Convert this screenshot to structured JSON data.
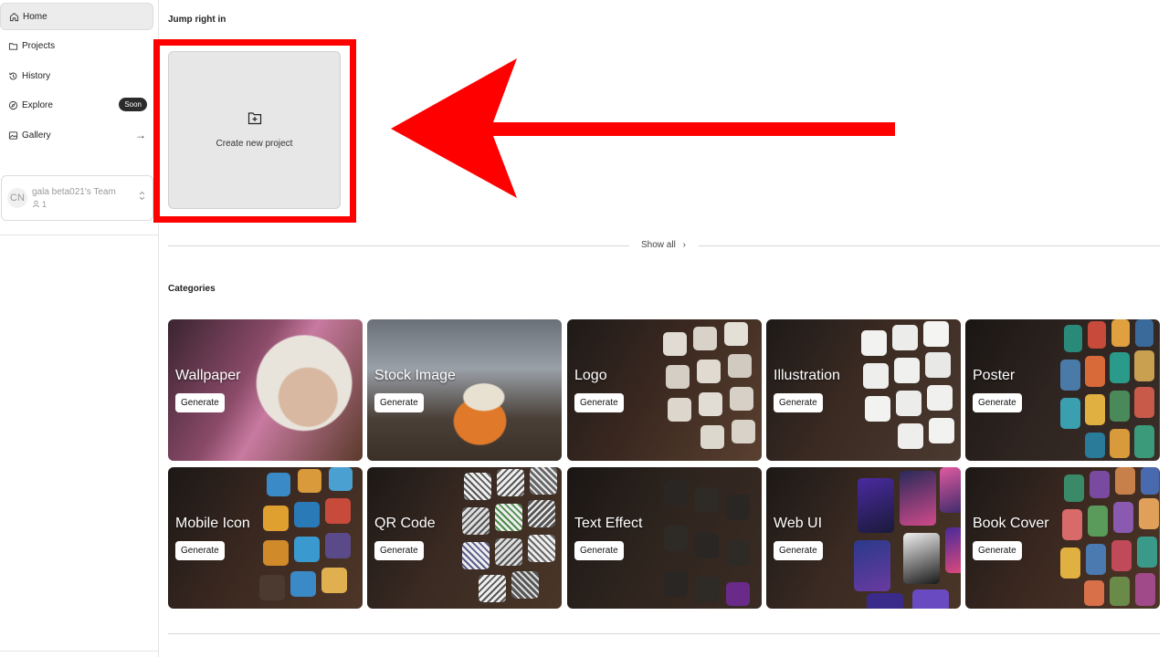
{
  "sidebar": {
    "items": [
      {
        "label": "Home",
        "icon": "home-icon",
        "active": true
      },
      {
        "label": "Projects",
        "icon": "folder-icon"
      },
      {
        "label": "History",
        "icon": "history-icon"
      },
      {
        "label": "Explore",
        "icon": "compass-icon",
        "badge": "Soon"
      },
      {
        "label": "Gallery",
        "icon": "gallery-icon"
      }
    ],
    "team": {
      "initials": "CN",
      "name": "gala beta021's Team",
      "members": "1"
    }
  },
  "main": {
    "jump_title": "Jump right in",
    "create_label": "Create new project",
    "show_all": "Show all",
    "categories_title": "Categories",
    "categories": [
      {
        "title": "Wallpaper",
        "button": "Generate"
      },
      {
        "title": "Stock Image",
        "button": "Generate"
      },
      {
        "title": "Logo",
        "button": "Generate"
      },
      {
        "title": "Illustration",
        "button": "Generate"
      },
      {
        "title": "Poster",
        "button": "Generate"
      },
      {
        "title": "Mobile Icon",
        "button": "Generate"
      },
      {
        "title": "QR Code",
        "button": "Generate"
      },
      {
        "title": "Text Effect",
        "button": "Generate"
      },
      {
        "title": "Web UI",
        "button": "Generate"
      },
      {
        "title": "Book Cover",
        "button": "Generate"
      }
    ]
  },
  "colors": {
    "highlight": "#ff0000",
    "badge_bg": "#2b2b2b"
  }
}
